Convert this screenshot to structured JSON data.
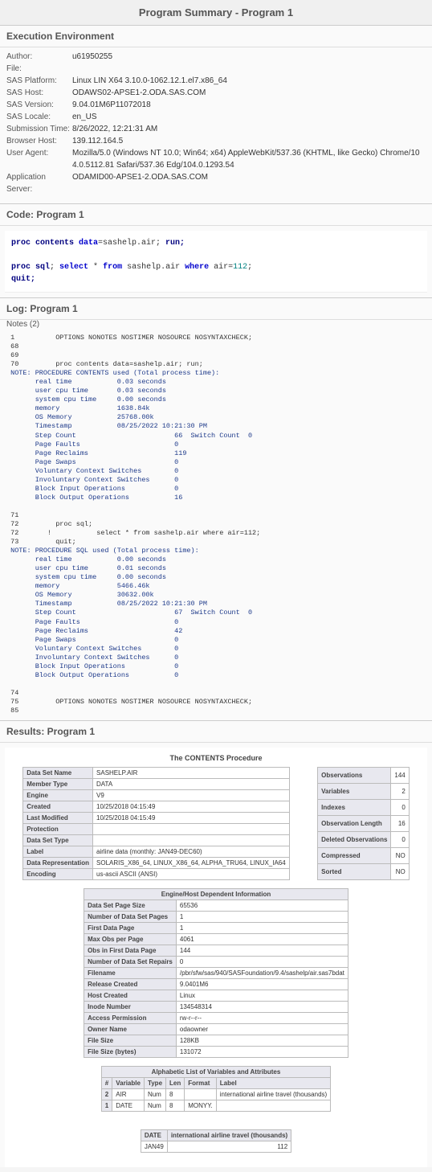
{
  "title": "Program Summary - Program 1",
  "env_header": "Execution Environment",
  "env": {
    "author_label": "Author:",
    "author": "u61950255",
    "file_label": "File:",
    "file": "",
    "platform_label": "SAS Platform:",
    "platform": "Linux LIN X64 3.10.0-1062.12.1.el7.x86_64",
    "host_label": "SAS Host:",
    "host": "ODAWS02-APSE1-2.ODA.SAS.COM",
    "version_label": "SAS Version:",
    "version": "9.04.01M6P11072018",
    "locale_label": "SAS Locale:",
    "locale": "en_US",
    "subtime_label": "Submission Time:",
    "subtime": "8/26/2022, 12:21:31 AM",
    "bhost_label": "Browser Host:",
    "bhost": "139.112.164.5",
    "ua_label": "User Agent:",
    "ua": "Mozilla/5.0 (Windows NT 10.0; Win64; x64) AppleWebKit/537.36 (KHTML, like Gecko) Chrome/104.0.5112.81 Safari/537.36 Edg/104.0.1293.54",
    "appserv_label": "Application Server:",
    "appserv": "ODAMID00-APSE1-2.ODA.SAS.COM"
  },
  "code_header": "Code: Program 1",
  "code": {
    "l1_a": "proc contents",
    "l1_b": " data",
    "l1_c": "=sashelp.air; ",
    "l1_d": "run;",
    "l2_a": "proc sql",
    "l2_b": "; ",
    "l2_c": "select",
    "l2_d": " * ",
    "l2_e": "from",
    "l2_f": " sashelp.air ",
    "l2_g": "where",
    "l2_h": " air=",
    "l2_i": "112",
    "l2_j": ";",
    "l3": "quit;"
  },
  "log_header": "Log: Program 1",
  "notes_label": "Notes (2)",
  "log_plain_1": " 1          OPTIONS NONOTES NOSTIMER NOSOURCE NOSYNTAXCHECK;\n 68         \n 69         \n 70         proc contents data=sashelp.air; run;\n",
  "log_note_1": " NOTE: PROCEDURE CONTENTS used (Total process time):\n       real time           0.03 seconds\n       user cpu time       0.03 seconds\n       system cpu time     0.00 seconds\n       memory              1638.84k\n       OS Memory           25768.00k\n       Timestamp           08/25/2022 10:21:30 PM\n       Step Count                        66  Switch Count  0\n       Page Faults                       0\n       Page Reclaims                     119\n       Page Swaps                        0\n       Voluntary Context Switches        0\n       Involuntary Context Switches      0\n       Block Input Operations            0\n       Block Output Operations           16\n       ",
  "log_plain_2": "\n 71         \n 72         proc sql;\n 72       !           select * from sashelp.air where air=112;\n 73         quit;",
  "log_note_2": "\n NOTE: PROCEDURE SQL used (Total process time):\n       real time           0.00 seconds\n       user cpu time       0.01 seconds\n       system cpu time     0.00 seconds\n       memory              5466.46k\n       OS Memory           30632.00k\n       Timestamp           08/25/2022 10:21:30 PM\n       Step Count                        67  Switch Count  0\n       Page Faults                       0\n       Page Reclaims                     42\n       Page Swaps                        0\n       Voluntary Context Switches        0\n       Involuntary Context Switches      0\n       Block Input Operations            0\n       Block Output Operations           0\n       ",
  "log_plain_3": "\n 74         \n 75         OPTIONS NONOTES NOSTIMER NOSOURCE NOSYNTAXCHECK;\n 85         ",
  "results_header": "Results: Program 1",
  "proc_title": "The CONTENTS Procedure",
  "contents_left": [
    [
      "Data Set Name",
      "SASHELP.AIR"
    ],
    [
      "Member Type",
      "DATA"
    ],
    [
      "Engine",
      "V9"
    ],
    [
      "Created",
      "10/25/2018 04:15:49"
    ],
    [
      "Last Modified",
      "10/25/2018 04:15:49"
    ],
    [
      "Protection",
      ""
    ],
    [
      "Data Set Type",
      ""
    ],
    [
      "Label",
      "airline data (monthly: JAN49-DEC60)"
    ],
    [
      "Data Representation",
      "SOLARIS_X86_64, LINUX_X86_64, ALPHA_TRU64, LINUX_IA64"
    ],
    [
      "Encoding",
      "us-ascii ASCII (ANSI)"
    ]
  ],
  "contents_right": [
    [
      "Observations",
      "144"
    ],
    [
      "Variables",
      "2"
    ],
    [
      "Indexes",
      "0"
    ],
    [
      "Observation Length",
      "16"
    ],
    [
      "Deleted Observations",
      "0"
    ],
    [
      "Compressed",
      "NO"
    ],
    [
      "Sorted",
      "NO"
    ]
  ],
  "engine_header": "Engine/Host Dependent Information",
  "engine_rows": [
    [
      "Data Set Page Size",
      "65536"
    ],
    [
      "Number of Data Set Pages",
      "1"
    ],
    [
      "First Data Page",
      "1"
    ],
    [
      "Max Obs per Page",
      "4061"
    ],
    [
      "Obs in First Data Page",
      "144"
    ],
    [
      "Number of Data Set Repairs",
      "0"
    ],
    [
      "Filename",
      "/pbr/sfw/sas/940/SASFoundation/9.4/sashelp/air.sas7bdat"
    ],
    [
      "Release Created",
      "9.0401M6"
    ],
    [
      "Host Created",
      "Linux"
    ],
    [
      "Inode Number",
      "134548314"
    ],
    [
      "Access Permission",
      "rw-r--r--"
    ],
    [
      "Owner Name",
      "odaowner"
    ],
    [
      "File Size",
      "128KB"
    ],
    [
      "File Size (bytes)",
      "131072"
    ]
  ],
  "vars_header": "Alphabetic List of Variables and Attributes",
  "vars_cols": [
    "#",
    "Variable",
    "Type",
    "Len",
    "Format",
    "Label"
  ],
  "vars_rows": [
    [
      "2",
      "AIR",
      "Num",
      "8",
      "",
      "international airline travel (thousands)"
    ],
    [
      "1",
      "DATE",
      "Num",
      "8",
      "MONYY.",
      ""
    ]
  ],
  "sql_cols": [
    "DATE",
    "international airline travel (thousands)"
  ],
  "sql_rows": [
    [
      "JAN49",
      "112"
    ]
  ]
}
